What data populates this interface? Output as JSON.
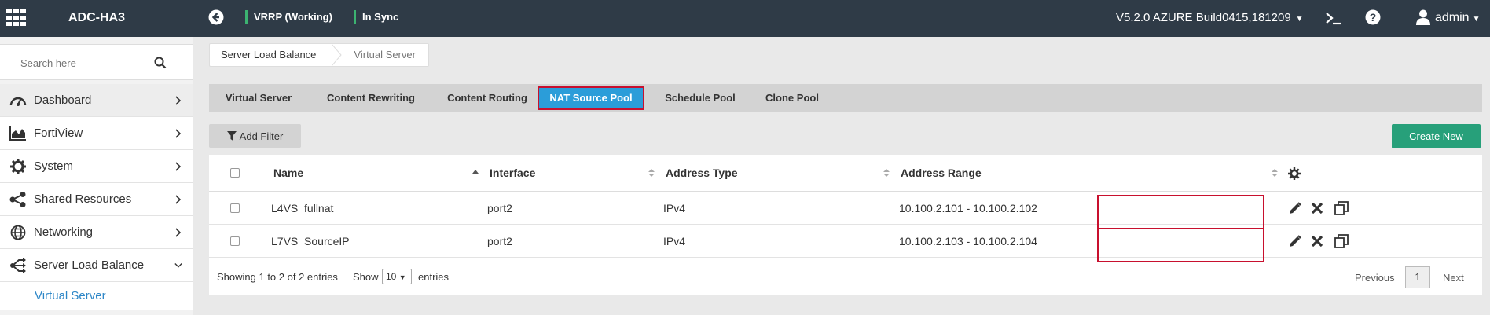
{
  "topbar": {
    "hostname": "ADC-HA3",
    "vrrp_status": "VRRP (Working)",
    "sync_status": "In Sync",
    "version": "V5.2.0 AZURE Build0415,181209",
    "user": "admin"
  },
  "sidebar": {
    "search_placeholder": "Search here",
    "items": [
      {
        "label": "Dashboard",
        "icon": "dashboard-icon"
      },
      {
        "label": "FortiView",
        "icon": "chart-icon"
      },
      {
        "label": "System",
        "icon": "gear-icon"
      },
      {
        "label": "Shared Resources",
        "icon": "share-icon"
      },
      {
        "label": "Networking",
        "icon": "globe-icon"
      },
      {
        "label": "Server Load Balance",
        "icon": "balance-icon"
      }
    ],
    "sub_items": [
      {
        "label": "Virtual Server"
      }
    ]
  },
  "breadcrumb": [
    "Server Load Balance",
    "Virtual Server"
  ],
  "tabs": [
    {
      "label": "Virtual Server"
    },
    {
      "label": "Content Rewriting"
    },
    {
      "label": "Content Routing"
    },
    {
      "label": "NAT Source Pool",
      "active": true
    },
    {
      "label": "Schedule Pool"
    },
    {
      "label": "Clone Pool"
    }
  ],
  "toolbar": {
    "add_filter": "Add Filter",
    "create_new": "Create New"
  },
  "table": {
    "columns": [
      "Name",
      "Interface",
      "Address Type",
      "Address Range"
    ],
    "rows": [
      {
        "name": "L4VS_fullnat",
        "interface": "port2",
        "address_type": "IPv4",
        "address_range": "10.100.2.101 - 10.100.2.102"
      },
      {
        "name": "L7VS_SourceIP",
        "interface": "port2",
        "address_type": "IPv4",
        "address_range": "10.100.2.103 - 10.100.2.104"
      }
    ]
  },
  "footer": {
    "showing": "Showing 1 to 2 of 2 entries",
    "show_label": "Show",
    "page_size": "10",
    "entries_label": "entries",
    "previous": "Previous",
    "page": "1",
    "next": "Next"
  },
  "colors": {
    "topbar": "#2f3b47",
    "active_tab": "#2b9dd9",
    "highlight": "#c8102e",
    "create_button": "#27a07a",
    "link": "#2c86c7"
  }
}
